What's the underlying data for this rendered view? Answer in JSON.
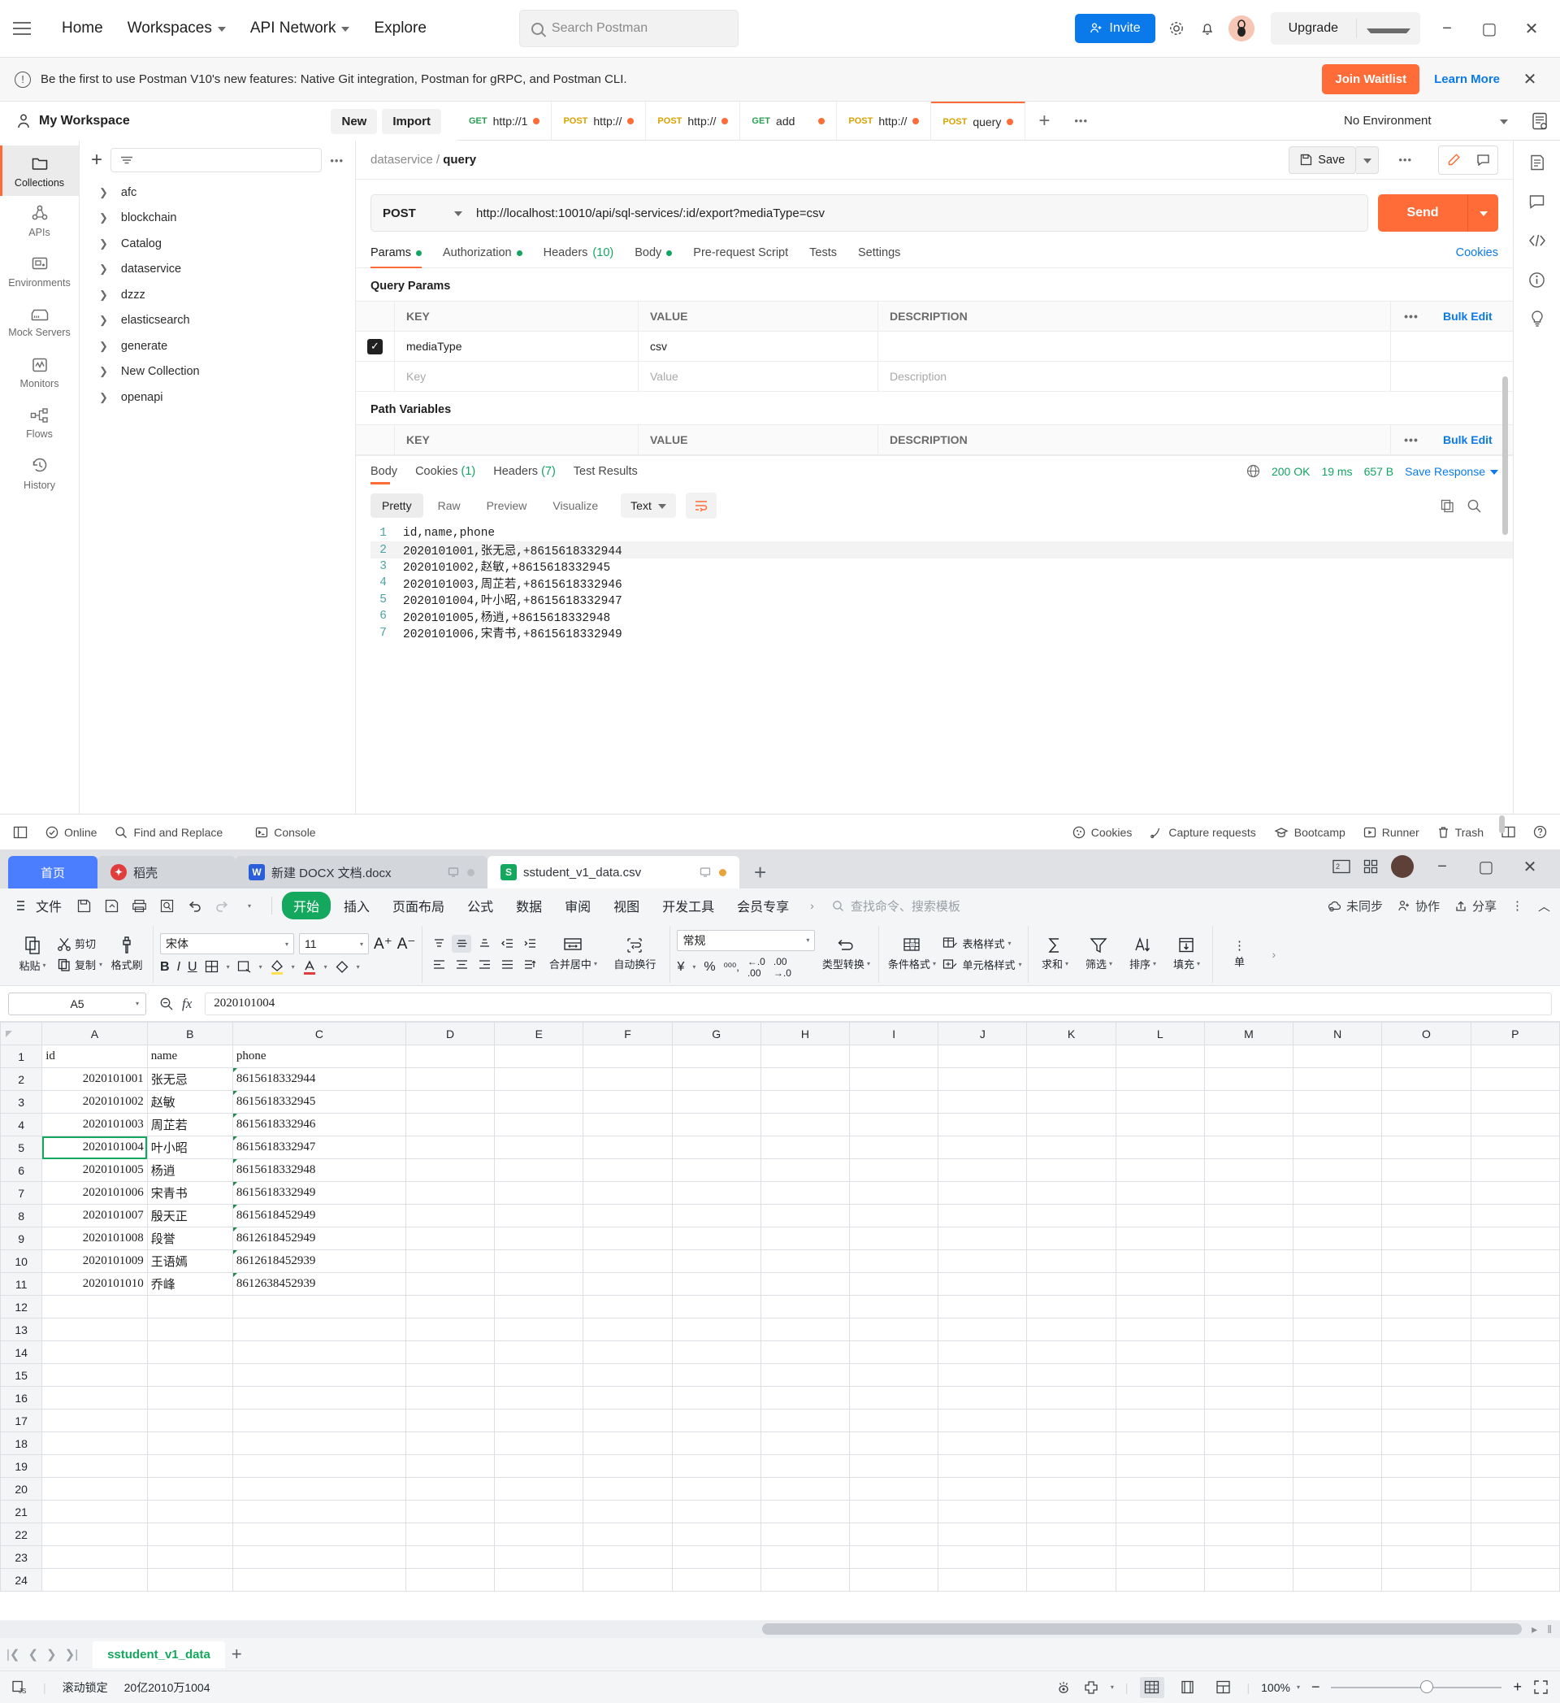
{
  "postman": {
    "nav": [
      {
        "label": "Home",
        "caret": false
      },
      {
        "label": "Workspaces",
        "caret": true
      },
      {
        "label": "API Network",
        "caret": true
      },
      {
        "label": "Explore",
        "caret": false
      }
    ],
    "search_placeholder": "Search Postman",
    "invite_label": "Invite",
    "upgrade_label": "Upgrade",
    "banner": {
      "text": "Be the first to use Postman V10's new features: Native Git integration, Postman for gRPC, and Postman CLI.",
      "join_label": "Join Waitlist",
      "learn_label": "Learn More"
    },
    "workspace": {
      "title": "My Workspace",
      "new_label": "New",
      "import_label": "Import"
    },
    "request_tabs": [
      {
        "verb": "GET",
        "verb_class": "get",
        "name": "http://1",
        "active": false
      },
      {
        "verb": "POST",
        "verb_class": "post",
        "name": "http://",
        "active": false
      },
      {
        "verb": "POST",
        "verb_class": "post",
        "name": "http://",
        "active": false
      },
      {
        "verb": "GET",
        "verb_class": "get",
        "name": "add",
        "active": false
      },
      {
        "verb": "POST",
        "verb_class": "post",
        "name": "http://",
        "active": false
      },
      {
        "verb": "POST",
        "verb_class": "post",
        "name": "query",
        "active": true
      }
    ],
    "environment": "No Environment",
    "rail": [
      {
        "label": "Collections",
        "icon": "folder-icon",
        "active": true
      },
      {
        "label": "APIs",
        "icon": "apis-icon",
        "active": false
      },
      {
        "label": "Environments",
        "icon": "environments-icon",
        "active": false
      },
      {
        "label": "Mock Servers",
        "icon": "mock-servers-icon",
        "active": false
      },
      {
        "label": "Monitors",
        "icon": "monitors-icon",
        "active": false
      },
      {
        "label": "Flows",
        "icon": "flows-icon",
        "active": false
      },
      {
        "label": "History",
        "icon": "history-icon",
        "active": false
      }
    ],
    "collections": [
      "afc",
      "blockchain",
      "Catalog",
      "dataservice",
      "dzzz",
      "elasticsearch",
      "generate",
      "New Collection",
      "openapi"
    ],
    "breadcrumb": {
      "collection": "dataservice",
      "request": "query",
      "separator": "/"
    },
    "save_label": "Save",
    "request": {
      "method": "POST",
      "url": "http://localhost:10010/api/sql-services/:id/export?mediaType=csv",
      "send_label": "Send"
    },
    "request_subtabs": [
      {
        "label": "Params",
        "dot": true,
        "count": "",
        "active": true
      },
      {
        "label": "Authorization",
        "dot": true,
        "count": "",
        "active": false
      },
      {
        "label": "Headers",
        "dot": false,
        "count": "(10)",
        "active": false
      },
      {
        "label": "Body",
        "dot": true,
        "count": "",
        "active": false
      },
      {
        "label": "Pre-request Script",
        "dot": false,
        "count": "",
        "active": false
      },
      {
        "label": "Tests",
        "dot": false,
        "count": "",
        "active": false
      },
      {
        "label": "Settings",
        "dot": false,
        "count": "",
        "active": false
      }
    ],
    "cookies_link": "Cookies",
    "query_params": {
      "title": "Query Params",
      "headers": {
        "key": "KEY",
        "value": "VALUE",
        "description": "DESCRIPTION",
        "bulk": "Bulk Edit"
      },
      "rows": [
        {
          "checked": true,
          "key": "mediaType",
          "value": "csv",
          "description": ""
        }
      ],
      "placeholder_row": {
        "key": "Key",
        "value": "Value",
        "description": "Description"
      }
    },
    "path_variables": {
      "title": "Path Variables",
      "headers": {
        "key": "KEY",
        "value": "VALUE",
        "description": "DESCRIPTION",
        "bulk": "Bulk Edit"
      }
    },
    "response_tabs": [
      {
        "label": "Body",
        "count": "",
        "active": true
      },
      {
        "label": "Cookies",
        "count": "(1)",
        "active": false
      },
      {
        "label": "Headers",
        "count": "(7)",
        "active": false
      },
      {
        "label": "Test Results",
        "count": "",
        "active": false
      }
    ],
    "response_meta": {
      "status": "200 OK",
      "time": "19 ms",
      "size": "657 B",
      "save_response": "Save Response"
    },
    "viewer_tabs": [
      "Pretty",
      "Raw",
      "Preview",
      "Visualize"
    ],
    "viewer_active": "Pretty",
    "viewer_format": "Text",
    "response_body_lines": [
      {
        "no": "1",
        "text": "id,name,phone",
        "highlight": false
      },
      {
        "no": "2",
        "text": "2020101001,张无忌,+8615618332944",
        "highlight": true
      },
      {
        "no": "3",
        "text": "2020101002,赵敏,+8615618332945",
        "highlight": false
      },
      {
        "no": "4",
        "text": "2020101003,周芷若,+8615618332946",
        "highlight": false
      },
      {
        "no": "5",
        "text": "2020101004,叶小昭,+8615618332947",
        "highlight": false
      },
      {
        "no": "6",
        "text": "2020101005,杨逍,+8615618332948",
        "highlight": false
      },
      {
        "no": "7",
        "text": "2020101006,宋青书,+8615618332949",
        "highlight": false
      }
    ],
    "status_bar": {
      "left": [
        {
          "label": "Online",
          "icon": "check-circle-icon"
        },
        {
          "label": "Find and Replace",
          "icon": "search-icon"
        },
        {
          "label": "Console",
          "icon": "console-icon"
        }
      ],
      "right": [
        {
          "label": "Cookies",
          "icon": "cookie-icon"
        },
        {
          "label": "Capture requests",
          "icon": "capture-icon"
        },
        {
          "label": "Bootcamp",
          "icon": "bootcamp-icon"
        },
        {
          "label": "Runner",
          "icon": "runner-icon"
        },
        {
          "label": "Trash",
          "icon": "trash-icon"
        }
      ]
    }
  },
  "wps": {
    "tabs": [
      {
        "label": "首页",
        "type": "home"
      },
      {
        "label": "稻壳",
        "type": "dk"
      },
      {
        "label": "新建 DOCX 文档.docx",
        "type": "docx"
      },
      {
        "label": "sstudent_v1_data.csv",
        "type": "csv"
      }
    ],
    "file_menu": "文件",
    "ribbon_tabs": [
      "开始",
      "插入",
      "页面布局",
      "公式",
      "数据",
      "审阅",
      "视图",
      "开发工具",
      "会员专享"
    ],
    "ribbon_active": "开始",
    "search_placeholder": "查找命令、搜索模板",
    "menu_right": [
      {
        "label": "未同步",
        "icon": "cloud-sync-icon"
      },
      {
        "label": "协作",
        "icon": "collaborate-icon"
      },
      {
        "label": "分享",
        "icon": "share-icon"
      }
    ],
    "clipboard": {
      "paste": "粘贴",
      "cut": "剪切",
      "copy": "复制",
      "format_painter": "格式刷"
    },
    "font": {
      "name": "宋体",
      "size": "11"
    },
    "alignment": {
      "merge": "合并居中",
      "wrap": "自动换行"
    },
    "number": {
      "format": "常规",
      "type_convert": "类型转换"
    },
    "styles": {
      "conditional": "条件格式",
      "table_style": "表格样式",
      "cell_style": "单元格样式"
    },
    "edit_group": {
      "sum": "求和",
      "filter": "筛选",
      "sort": "排序",
      "fill": "填充",
      "cells": "单"
    },
    "name_box": "A5",
    "formula_value": "2020101004",
    "columns": [
      "A",
      "B",
      "C",
      "D",
      "E",
      "F",
      "G",
      "H",
      "I",
      "J",
      "K",
      "L",
      "M",
      "N",
      "O",
      "P"
    ],
    "selected_column": "A",
    "selected_row": 5,
    "sheet_headers": [
      "id",
      "name",
      "phone"
    ],
    "sheet_rows": [
      {
        "row": 1,
        "a": "id",
        "b": "name",
        "c": "phone",
        "is_header": true
      },
      {
        "row": 2,
        "a": "2020101001",
        "b": "张无忌",
        "c": "8615618332944"
      },
      {
        "row": 3,
        "a": "2020101002",
        "b": "赵敏",
        "c": "8615618332945"
      },
      {
        "row": 4,
        "a": "2020101003",
        "b": "周芷若",
        "c": "8615618332946"
      },
      {
        "row": 5,
        "a": "2020101004",
        "b": "叶小昭",
        "c": "8615618332947"
      },
      {
        "row": 6,
        "a": "2020101005",
        "b": "杨逍",
        "c": "8615618332948"
      },
      {
        "row": 7,
        "a": "2020101006",
        "b": "宋青书",
        "c": "8615618332949"
      },
      {
        "row": 8,
        "a": "2020101007",
        "b": "殷天正",
        "c": "8615618452949"
      },
      {
        "row": 9,
        "a": "2020101008",
        "b": "段誉",
        "c": "8612618452949"
      },
      {
        "row": 10,
        "a": "2020101009",
        "b": "王语嫣",
        "c": "8612618452939"
      },
      {
        "row": 11,
        "a": "2020101010",
        "b": "乔峰",
        "c": "8612638452939"
      },
      {
        "row": 12,
        "a": "",
        "b": "",
        "c": ""
      },
      {
        "row": 13,
        "a": "",
        "b": "",
        "c": ""
      },
      {
        "row": 14,
        "a": "",
        "b": "",
        "c": ""
      },
      {
        "row": 15,
        "a": "",
        "b": "",
        "c": ""
      },
      {
        "row": 16,
        "a": "",
        "b": "",
        "c": ""
      },
      {
        "row": 17,
        "a": "",
        "b": "",
        "c": ""
      },
      {
        "row": 18,
        "a": "",
        "b": "",
        "c": ""
      },
      {
        "row": 19,
        "a": "",
        "b": "",
        "c": ""
      },
      {
        "row": 20,
        "a": "",
        "b": "",
        "c": ""
      },
      {
        "row": 21,
        "a": "",
        "b": "",
        "c": ""
      },
      {
        "row": 22,
        "a": "",
        "b": "",
        "c": ""
      },
      {
        "row": 23,
        "a": "",
        "b": "",
        "c": ""
      },
      {
        "row": 24,
        "a": "",
        "b": "",
        "c": ""
      }
    ],
    "sheet_tab": "sstudent_v1_data",
    "status": {
      "scroll_lock": "滚动锁定",
      "sum_text": "20亿2010万1004",
      "zoom": "100%"
    }
  }
}
